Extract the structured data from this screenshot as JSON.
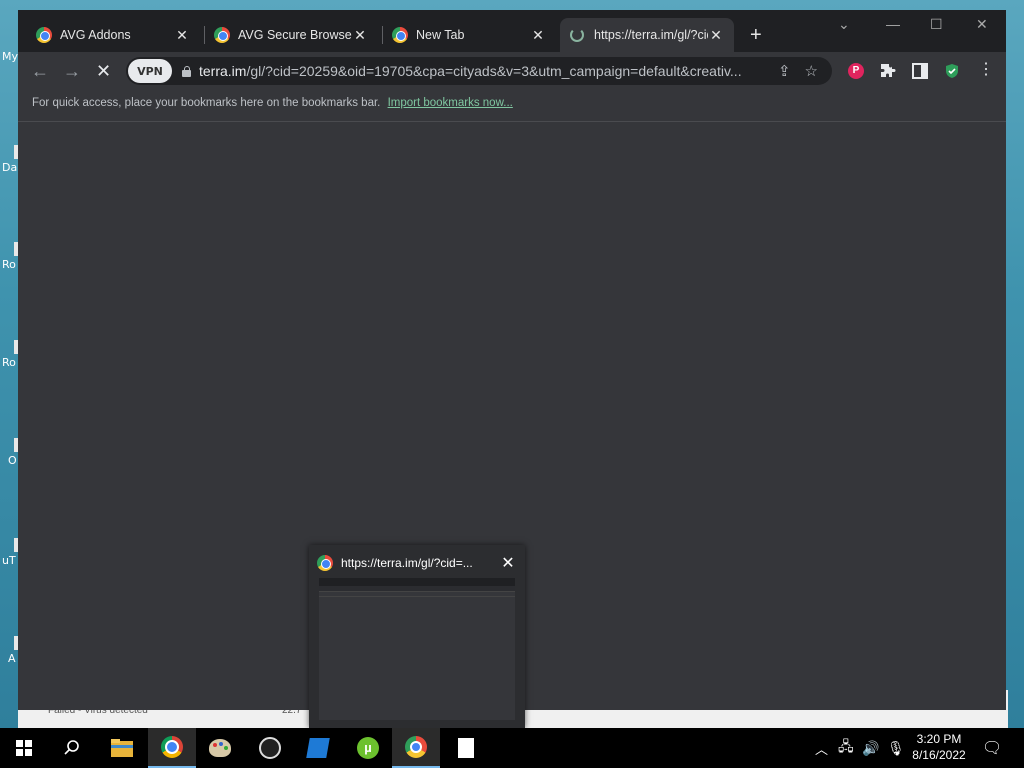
{
  "desktop": {
    "icons": [
      "My",
      "Da",
      "Ro",
      "Ro",
      "O",
      "uT",
      "A"
    ],
    "behind_status": "Failed - Virus detected",
    "behind_size": "22.7"
  },
  "browser": {
    "tabs": [
      {
        "label": "AVG Addons",
        "close": "✕"
      },
      {
        "label": "AVG Secure Browser S",
        "close": "✕"
      },
      {
        "label": "New Tab",
        "close": "✕"
      },
      {
        "label": "https://terra.im/gl/?cid",
        "close": "✕"
      }
    ],
    "new_tab": "+",
    "window_controls": {
      "dropdown": "⌄",
      "minimize": "—",
      "maximize": "☐",
      "close": "✕"
    },
    "nav": {
      "back": "←",
      "forward": "→",
      "stop": "✕"
    },
    "vpn_label": "VPN",
    "url_host": "terra.im",
    "url_rest": "/gl/?cid=20259&oid=19705&cpa=cityads&v=3&utm_campaign=default&creativ...",
    "bookmarks_bar_text": "For quick access, place your bookmarks here on the bookmarks bar.",
    "bookmarks_bar_link": "Import bookmarks now...",
    "extensions": {
      "profile_letter": "P"
    }
  },
  "preview": {
    "title": "https://terra.im/gl/?cid=...",
    "close": "✕"
  },
  "taskbar": {
    "clock_time": "3:20 PM",
    "clock_date": "8/16/2022"
  },
  "colors": {
    "accent_green": "#7fc6a0",
    "browser_bg": "#35363a",
    "tabstrip_bg": "#1f2023"
  }
}
